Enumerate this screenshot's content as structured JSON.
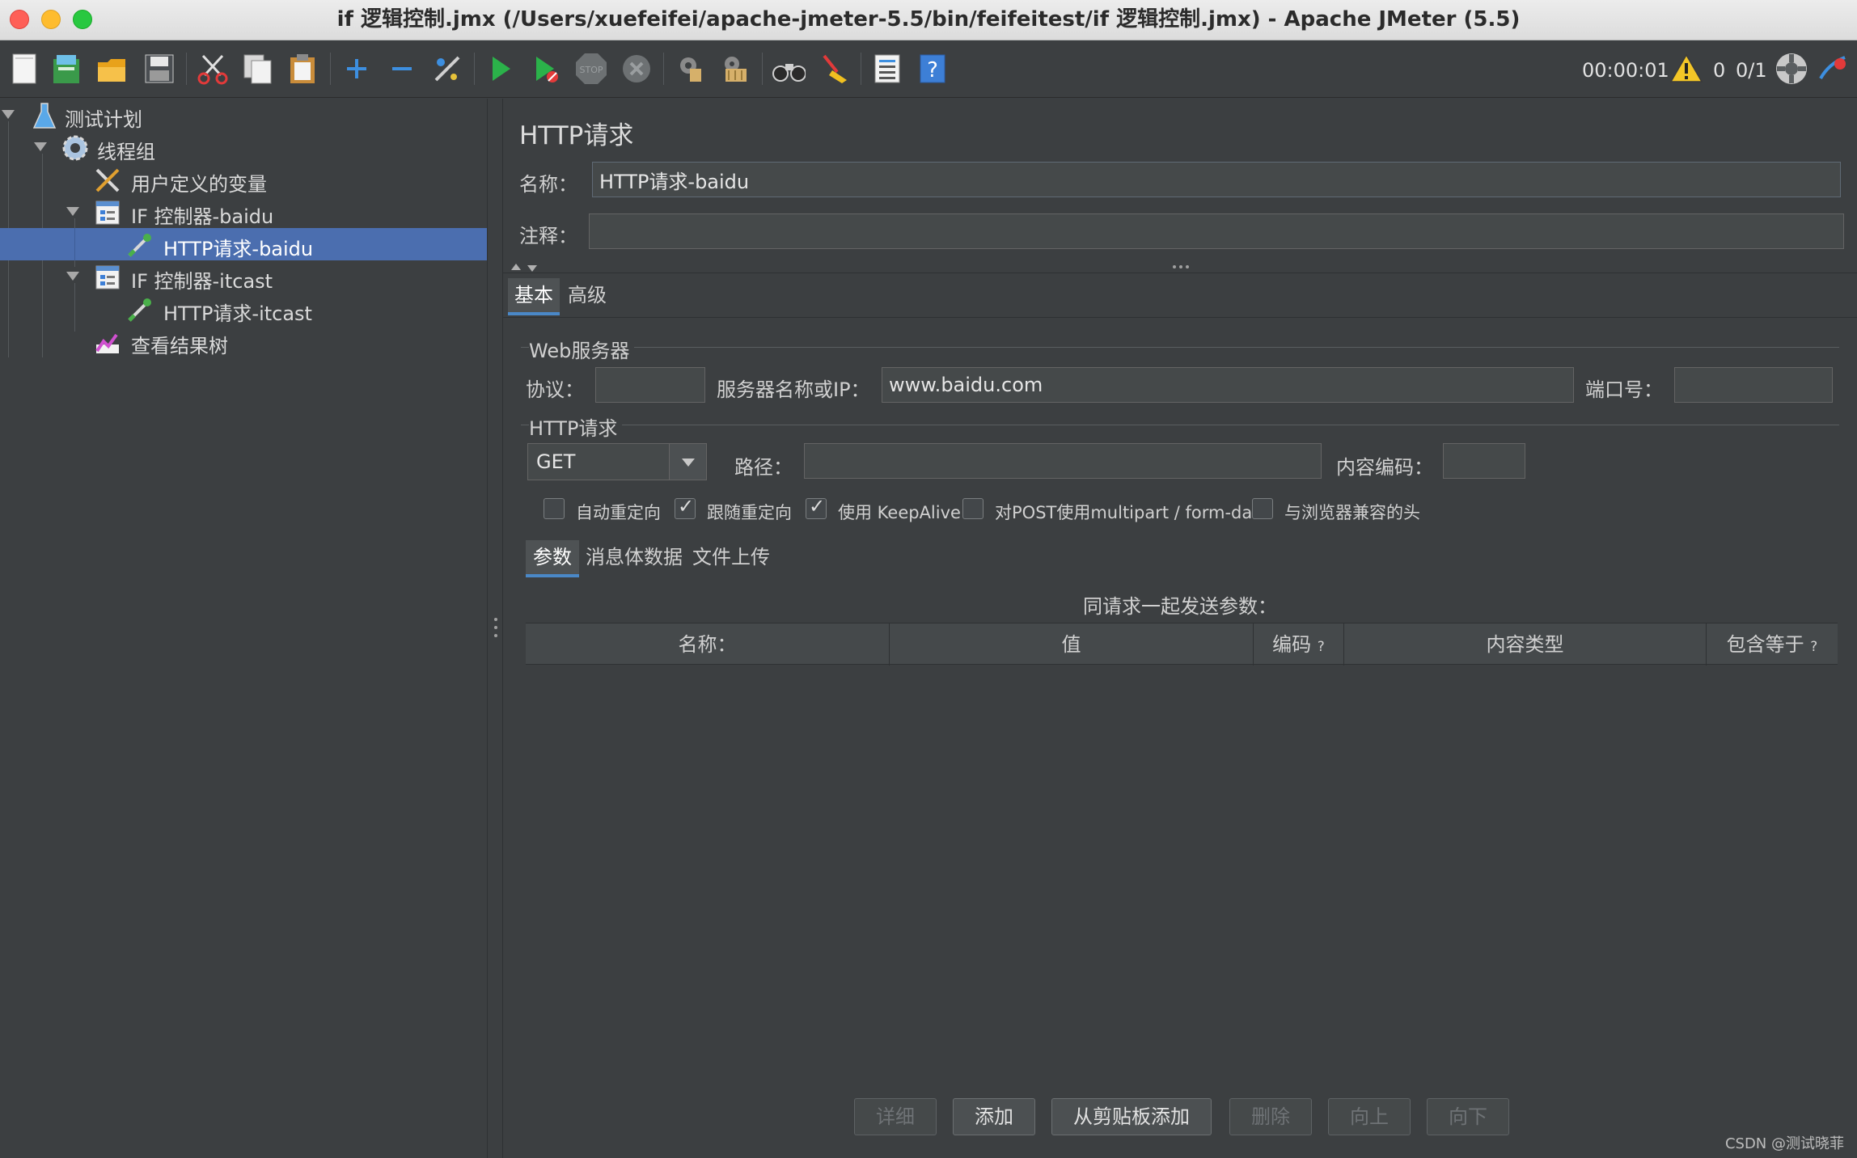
{
  "window": {
    "title": "if 逻辑控制.jmx (/Users/xuefeifei/apache-jmeter-5.5/bin/feifeitest/if 逻辑控制.jmx) - Apache JMeter (5.5)"
  },
  "toolbar": {
    "icons": [
      "new-icon",
      "templates-icon",
      "open-icon",
      "save-icon",
      "cut-icon",
      "copy-icon",
      "paste-icon",
      "expand-icon",
      "collapse-icon",
      "toggle-icon",
      "start-icon",
      "start-no-pause-icon",
      "stop-icon",
      "shutdown-icon",
      "clear-icon",
      "clear-all-icon",
      "search-icon",
      "reset-search-icon",
      "function-helper-icon",
      "help-icon"
    ],
    "timer": "00:00:01",
    "warning_count": "0",
    "thread_ratio": "0/1"
  },
  "tree": {
    "items": [
      {
        "label": "测试计划",
        "icon": "test-plan-icon"
      },
      {
        "label": "线程组",
        "icon": "thread-group-icon"
      },
      {
        "label": "用户定义的变量",
        "icon": "user-variables-icon"
      },
      {
        "label": "IF 控制器-baidu",
        "icon": "if-controller-icon"
      },
      {
        "label": "HTTP请求-baidu",
        "icon": "http-sampler-icon"
      },
      {
        "label": "IF 控制器-itcast",
        "icon": "if-controller-icon"
      },
      {
        "label": "HTTP请求-itcast",
        "icon": "http-sampler-icon"
      },
      {
        "label": "查看结果树",
        "icon": "results-tree-icon"
      }
    ],
    "selected_index": 4
  },
  "panel": {
    "title": "HTTP请求",
    "name_label": "名称：",
    "name_value": "HTTP请求-baidu",
    "comment_label": "注释：",
    "comment_value": "",
    "tabs": [
      "基本",
      "高级"
    ],
    "web_server": {
      "group_title": "Web服务器",
      "protocol_label": "协议：",
      "protocol_value": "",
      "server_label": "服务器名称或IP：",
      "server_value": "www.baidu.com",
      "port_label": "端口号：",
      "port_value": ""
    },
    "http_request": {
      "group_title": "HTTP请求",
      "method": "GET",
      "path_label": "路径：",
      "path_value": "",
      "encoding_label": "内容编码：",
      "encoding_value": ""
    },
    "checkboxes": [
      {
        "label": "自动重定向",
        "checked": false
      },
      {
        "label": "跟随重定向",
        "checked": true
      },
      {
        "label": "使用 KeepAlive",
        "checked": true
      },
      {
        "label": "对POST使用multipart / form-data",
        "checked": false
      },
      {
        "label": "与浏览器兼容的头",
        "checked": false
      }
    ],
    "sub_tabs": [
      "参数",
      "消息体数据",
      "文件上传"
    ],
    "params_caption": "同请求一起发送参数：",
    "table_headers": [
      "名称：",
      "值",
      "编码",
      "内容类型",
      "包含等于"
    ],
    "help_mark": "?",
    "buttons": [
      {
        "label": "详细",
        "enabled": false
      },
      {
        "label": "添加",
        "enabled": true
      },
      {
        "label": "从剪贴板添加",
        "enabled": true
      },
      {
        "label": "删除",
        "enabled": false
      },
      {
        "label": "向上",
        "enabled": false
      },
      {
        "label": "向下",
        "enabled": false
      }
    ]
  },
  "watermark": "CSDN @测试晓菲",
  "colors": {
    "background": "#3c3f41",
    "selection": "#4b6eaf",
    "tab_accent": "#4a88c7"
  }
}
